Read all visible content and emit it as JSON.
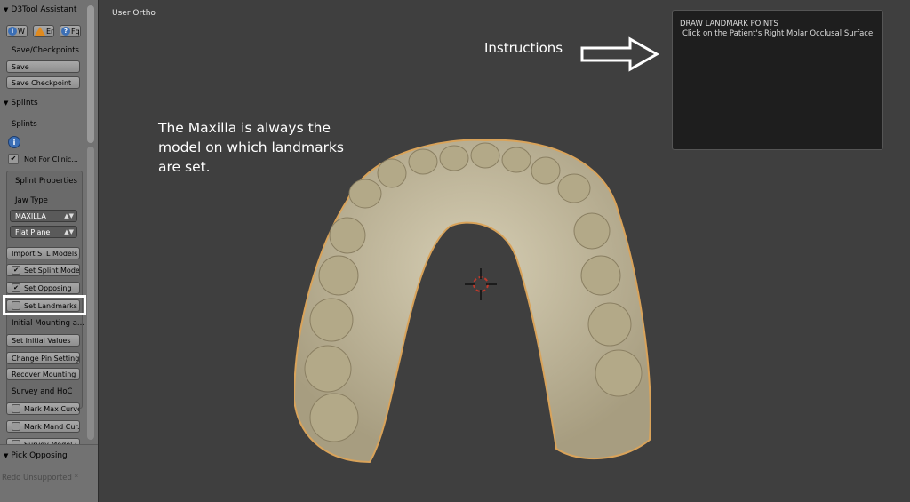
{
  "panel": {
    "assistant_header": "D3Tool Assistant",
    "icon_buttons": [
      {
        "icon": "info-icon",
        "label": "W"
      },
      {
        "icon": "warning-icon",
        "label": "Er"
      },
      {
        "icon": "help-icon",
        "label": "Fq"
      }
    ],
    "save_section_label": "Save/Checkpoints",
    "save_label": "Save",
    "save_checkpoint_label": "Save Checkpoint",
    "splints_header": "Splints",
    "splints_label": "Splints",
    "not_for_clinical_label": "Not For Clinic...",
    "splint_properties_label": "Splint Properties",
    "jaw_type_label": "Jaw Type",
    "jaw_type_value": "MAXILLA",
    "plane_value": "Flat Plane",
    "import_stl_label": "Import STL Models",
    "set_splint_model_label": "Set Splint Model",
    "set_opposing_label": "Set Opposing",
    "set_landmarks_label": "Set Landmarks",
    "initial_mounting_label": "Initial Mounting a...",
    "set_initial_values_label": "Set Initial Values",
    "change_pin_setting_label": "Change Pin Setting",
    "recover_mounting_label": "Recover Mounting",
    "survey_hoc_label": "Survey and HoC",
    "mark_max_curve_label": "Mark Max Curve",
    "mark_mand_curve_label": "Mark Mand Cur...",
    "survey_model_label": "Survey Model (...",
    "pick_opposing_header": "Pick Opposing",
    "redo_label": "Redo Unsupported *"
  },
  "viewport": {
    "view_label": "User Ortho",
    "note_text": "The Maxilla is always the model on which landmarks are set.",
    "instructions_label": "Instructions",
    "instructions_title": "DRAW LANDMARK POINTS",
    "instructions_body": "Click on the Patient's Right Molar Occlusal Surface"
  },
  "colors": {
    "panel_bg": "#727272",
    "viewport_bg": "#3f3f3f",
    "model_fill": "#c8bfa4",
    "model_outline": "#d9a35a",
    "highlight": "#ffffff"
  }
}
